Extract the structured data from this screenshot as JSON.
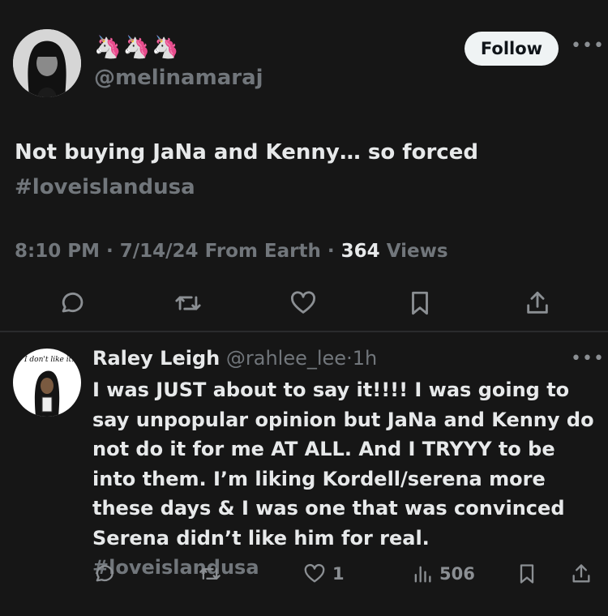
{
  "main_tweet": {
    "display_name": "🦄🦄🦄",
    "handle": "@melinamaraj",
    "follow_label": "Follow",
    "more_label": "•••",
    "text": "Not buying JaNa and Kenny… so forced",
    "hashtag": "#loveislandusa",
    "meta": {
      "time": "8:10 PM",
      "date": "7/14/24",
      "source": "From Earth",
      "views_count": "364",
      "views_label": "Views"
    },
    "actions": [
      "reply-icon",
      "retweet-icon",
      "like-icon",
      "bookmark-icon",
      "share-icon"
    ]
  },
  "reply": {
    "name": "Raley Leigh",
    "handle": "@rahlee_lee",
    "time": "1h",
    "avatar_tag": "I don't like it.",
    "more_label": "•••",
    "text": "I was JUST about to say it!!!! I was going to say unpopular opinion but JaNa and Kenny do not do it for me AT ALL. And I TRYYY to be into them. I’m liking Kordell/serena more these days & I was one that was convinced Serena didn’t like him for real.",
    "hashtag": "#loveislandusa",
    "like_count": "1",
    "views_count": "506"
  },
  "colors": {
    "background": "#161616",
    "text": "#e7e9ea",
    "muted": "#71767b",
    "button_bg": "#eff3f4"
  }
}
